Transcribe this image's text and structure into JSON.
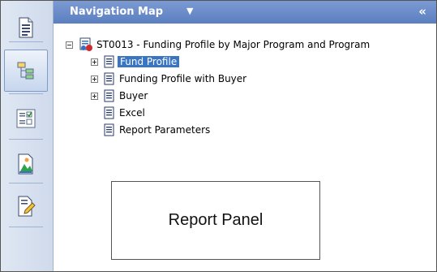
{
  "header": {
    "title": "Navigation Map",
    "dropdown_icon": "caret-down-icon",
    "collapse_label": "«"
  },
  "rail": {
    "items": [
      {
        "name": "document-icon"
      },
      {
        "name": "tree-structure-icon",
        "active": true
      },
      {
        "name": "checklist-icon"
      },
      {
        "name": "chart-image-icon"
      },
      {
        "name": "edit-document-icon"
      }
    ]
  },
  "tree": {
    "root_label": "ST0013 - Funding Profile by Major Program and Program",
    "children": [
      {
        "label": "Fund Profile",
        "expandable": true,
        "selected": true
      },
      {
        "label": "Funding Profile with Buyer",
        "expandable": true,
        "selected": false
      },
      {
        "label": "Buyer",
        "expandable": true,
        "selected": false
      },
      {
        "label": "Excel",
        "expandable": false,
        "selected": false
      },
      {
        "label": "Report Parameters",
        "expandable": false,
        "selected": false
      }
    ]
  },
  "report_panel": {
    "label": "Report Panel"
  },
  "colors": {
    "header_bg": "#5b7fc0",
    "selection_bg": "#3a75c4",
    "rail_bg": "#d7e1f1"
  }
}
